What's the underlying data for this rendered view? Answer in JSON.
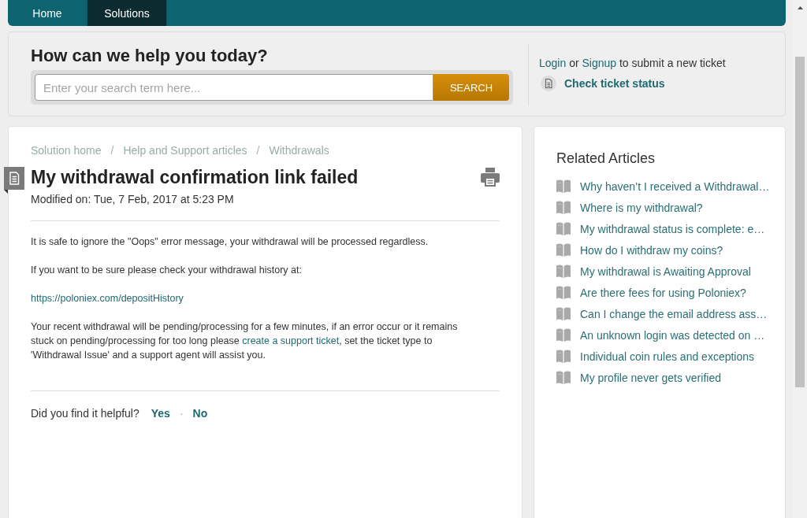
{
  "nav": {
    "tabs": [
      {
        "label": "Home",
        "selected": false
      },
      {
        "label": "Solutions",
        "selected": true
      }
    ]
  },
  "search": {
    "heading": "How can we help you today?",
    "placeholder": "Enter your search term here...",
    "button": "SEARCH"
  },
  "account": {
    "parts": [
      {
        "kind": "link",
        "text": "Login"
      },
      {
        "kind": "text",
        "text": " or "
      },
      {
        "kind": "link",
        "text": "Signup"
      },
      {
        "kind": "text",
        "text": " to submit a new ticket"
      }
    ],
    "status_link": "Check ticket status"
  },
  "article": {
    "breadcrumbs": [
      {
        "kind": "link",
        "text": "Solution home"
      },
      {
        "kind": "separator",
        "text": "/"
      },
      {
        "kind": "link",
        "text": "Help and Support articles"
      },
      {
        "kind": "separator",
        "text": "/"
      },
      {
        "kind": "link",
        "text": "Withdrawals"
      }
    ],
    "title": "My withdrawal confirmation link failed",
    "modified": "Modified on: Tue, 7 Feb, 2017 at 5:23 PM",
    "paragraphs": [
      {
        "parts": [
          {
            "kind": "text",
            "text": "It is safe to ignore the \"Oops\" error message, your withdrawal will be processed regardless."
          }
        ]
      },
      {
        "parts": [
          {
            "kind": "text",
            "text": "If you want to be sure please check your withdrawal history at:"
          }
        ]
      },
      {
        "parts": [
          {
            "kind": "link",
            "text": "https://poloniex.com/depositHistory"
          }
        ]
      },
      {
        "parts": [
          {
            "kind": "text",
            "text": "Your recent withdrawal will be pending/processing for a few minutes, if an error occur or it remains stuck on pending/processing for too long please "
          },
          {
            "kind": "link",
            "text": "create a support ticket"
          },
          {
            "kind": "text",
            "text": ", set the ticket type to 'Withdrawal Issue' and a support agent will assist you."
          }
        ]
      }
    ],
    "feedback": {
      "question": "Did you find it helpful?",
      "options": [
        {
          "label": "Yes"
        },
        {
          "label": "No"
        }
      ],
      "separator": "·"
    }
  },
  "related": {
    "title": "Related Articles",
    "items": [
      "Why haven’t I received a Withdrawal…",
      "Where is my withdrawal?",
      "My withdrawal status is complete: e…",
      "How do I withdraw my coins?",
      "My withdrawal is Awaiting Approval",
      "Are there fees for using Poloniex?",
      "Can I change the email address ass…",
      "An unknown login was detected on …",
      "Individual coin rules and exceptions",
      "My profile never gets verified"
    ]
  }
}
